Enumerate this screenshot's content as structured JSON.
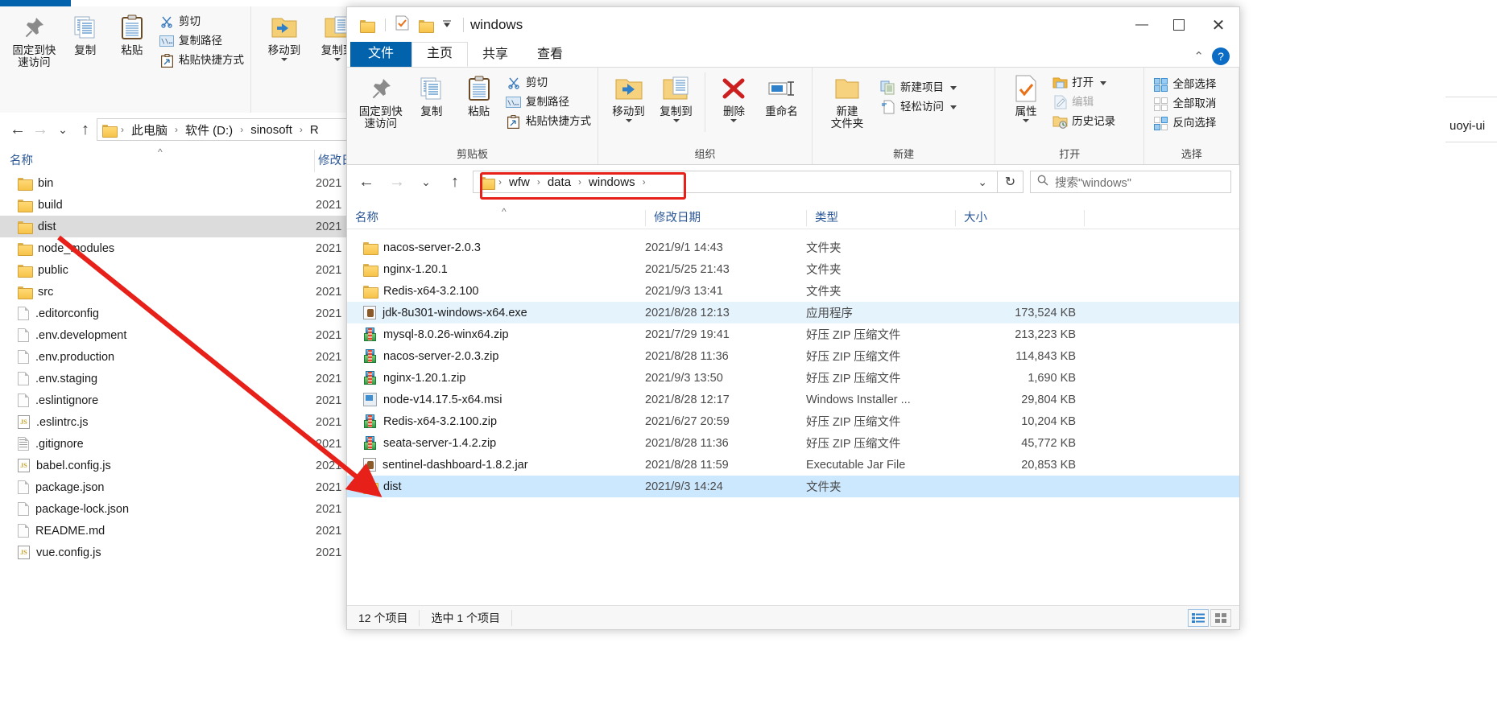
{
  "ribbon_common": {
    "tabs": {
      "file": "文件",
      "home": "主页",
      "share": "共享",
      "view": "查看"
    },
    "clipboard": {
      "group_title": "剪贴板",
      "pin": "固定到快\n速访问",
      "pin_l1": "固定到快",
      "pin_l2": "速访问",
      "copy": "复制",
      "paste": "粘贴",
      "cut": "剪切",
      "copy_path": "复制路径",
      "paste_shortcut": "粘贴快捷方式"
    },
    "organize": {
      "group_title": "组织",
      "move_to": "移动到",
      "copy_to": "复制到",
      "delete": "删除",
      "rename": "重命名"
    },
    "new": {
      "group_title": "新建",
      "new_folder_l1": "新建",
      "new_folder_l2": "文件夹",
      "new_item": "新建项目",
      "easy_access": "轻松访问"
    },
    "open": {
      "group_title": "打开",
      "properties": "属性",
      "open": "打开",
      "edit": "编辑",
      "history": "历史记录"
    },
    "select": {
      "group_title": "选择",
      "select_all": "全部选择",
      "select_none": "全部取消",
      "invert": "反向选择"
    }
  },
  "back_window": {
    "address": {
      "crumbs": [
        "此电脑",
        "软件 (D:)",
        "sinosoft",
        "R"
      ]
    },
    "columns": {
      "name": "名称",
      "modified": "修改日"
    },
    "files": [
      {
        "name": "bin",
        "icon": "folder",
        "date": "2021"
      },
      {
        "name": "build",
        "icon": "folder",
        "date": "2021"
      },
      {
        "name": "dist",
        "icon": "folder",
        "date": "2021",
        "selected": true
      },
      {
        "name": "node_modules",
        "icon": "folder",
        "date": "2021"
      },
      {
        "name": "public",
        "icon": "folder",
        "date": "2021"
      },
      {
        "name": "src",
        "icon": "folder",
        "date": "2021"
      },
      {
        "name": ".editorconfig",
        "icon": "doc",
        "date": "2021"
      },
      {
        "name": ".env.development",
        "icon": "doc",
        "date": "2021"
      },
      {
        "name": ".env.production",
        "icon": "doc",
        "date": "2021"
      },
      {
        "name": ".env.staging",
        "icon": "doc",
        "date": "2021"
      },
      {
        "name": ".eslintignore",
        "icon": "doc",
        "date": "2021"
      },
      {
        "name": ".eslintrc.js",
        "icon": "js",
        "date": "2021"
      },
      {
        "name": ".gitignore",
        "icon": "doclines",
        "date": "2021"
      },
      {
        "name": "babel.config.js",
        "icon": "js",
        "date": "2021"
      },
      {
        "name": "package.json",
        "icon": "doc",
        "date": "2021"
      },
      {
        "name": "package-lock.json",
        "icon": "doc",
        "date": "2021"
      },
      {
        "name": "README.md",
        "icon": "doc",
        "date": "2021"
      },
      {
        "name": "vue.config.js",
        "icon": "js",
        "date": "2021"
      }
    ],
    "right_fragment": "uoyi-ui"
  },
  "front_window": {
    "title": "windows",
    "titlebar_icons": {
      "minimize": "—",
      "maximize": "▢",
      "close": "✕"
    },
    "quick_access": [
      "folder-icon",
      "check-icon",
      "folder-icon",
      "dropdown-icon"
    ],
    "ribbon_collapse": "^",
    "help": "?",
    "address": {
      "crumbs": [
        "wfw",
        "data",
        "windows"
      ],
      "refresh_icon": "↻",
      "dropdown_icon": "⌄"
    },
    "search": {
      "placeholder": "搜索\"windows\""
    },
    "columns": {
      "name": "名称",
      "modified": "修改日期",
      "type": "类型",
      "size": "大小"
    },
    "files": [
      {
        "name": "nacos-server-2.0.3",
        "icon": "folder",
        "date": "2021/9/1 14:43",
        "type": "文件夹",
        "size": ""
      },
      {
        "name": "nginx-1.20.1",
        "icon": "folder",
        "date": "2021/5/25 21:43",
        "type": "文件夹",
        "size": ""
      },
      {
        "name": "Redis-x64-3.2.100",
        "icon": "folder",
        "date": "2021/9/3 13:41",
        "type": "文件夹",
        "size": ""
      },
      {
        "name": "jdk-8u301-windows-x64.exe",
        "icon": "java",
        "date": "2021/8/28 12:13",
        "type": "应用程序",
        "size": "173,524 KB",
        "hover": true
      },
      {
        "name": "mysql-8.0.26-winx64.zip",
        "icon": "zip",
        "date": "2021/7/29 19:41",
        "type": "好压 ZIP 压缩文件",
        "size": "213,223 KB"
      },
      {
        "name": "nacos-server-2.0.3.zip",
        "icon": "zip",
        "date": "2021/8/28 11:36",
        "type": "好压 ZIP 压缩文件",
        "size": "114,843 KB"
      },
      {
        "name": "nginx-1.20.1.zip",
        "icon": "zip",
        "date": "2021/9/3 13:50",
        "type": "好压 ZIP 压缩文件",
        "size": "1,690 KB"
      },
      {
        "name": "node-v14.17.5-x64.msi",
        "icon": "msi",
        "date": "2021/8/28 12:17",
        "type": "Windows Installer ...",
        "size": "29,804 KB"
      },
      {
        "name": "Redis-x64-3.2.100.zip",
        "icon": "zip",
        "date": "2021/6/27 20:59",
        "type": "好压 ZIP 压缩文件",
        "size": "10,204 KB"
      },
      {
        "name": "seata-server-1.4.2.zip",
        "icon": "zip",
        "date": "2021/8/28 11:36",
        "type": "好压 ZIP 压缩文件",
        "size": "45,772 KB"
      },
      {
        "name": "sentinel-dashboard-1.8.2.jar",
        "icon": "java",
        "date": "2021/8/28 11:59",
        "type": "Executable Jar File",
        "size": "20,853 KB"
      },
      {
        "name": "dist",
        "icon": "folder",
        "date": "2021/9/3 14:24",
        "type": "文件夹",
        "size": "",
        "selected": true
      }
    ],
    "status": {
      "count": "12 个项目",
      "selected": "选中 1 个项目"
    }
  },
  "annotations": {
    "red_arrow": "red-arrow-from-dist-to-dist",
    "red_box_label": "address-path-highlight"
  },
  "colors": {
    "accent_blue": "#0263ac",
    "selection_blue": "#cce8ff",
    "hover_blue": "#e5f3fd",
    "annotation_red": "#e8201a",
    "header_text_blue": "#2b5797"
  }
}
